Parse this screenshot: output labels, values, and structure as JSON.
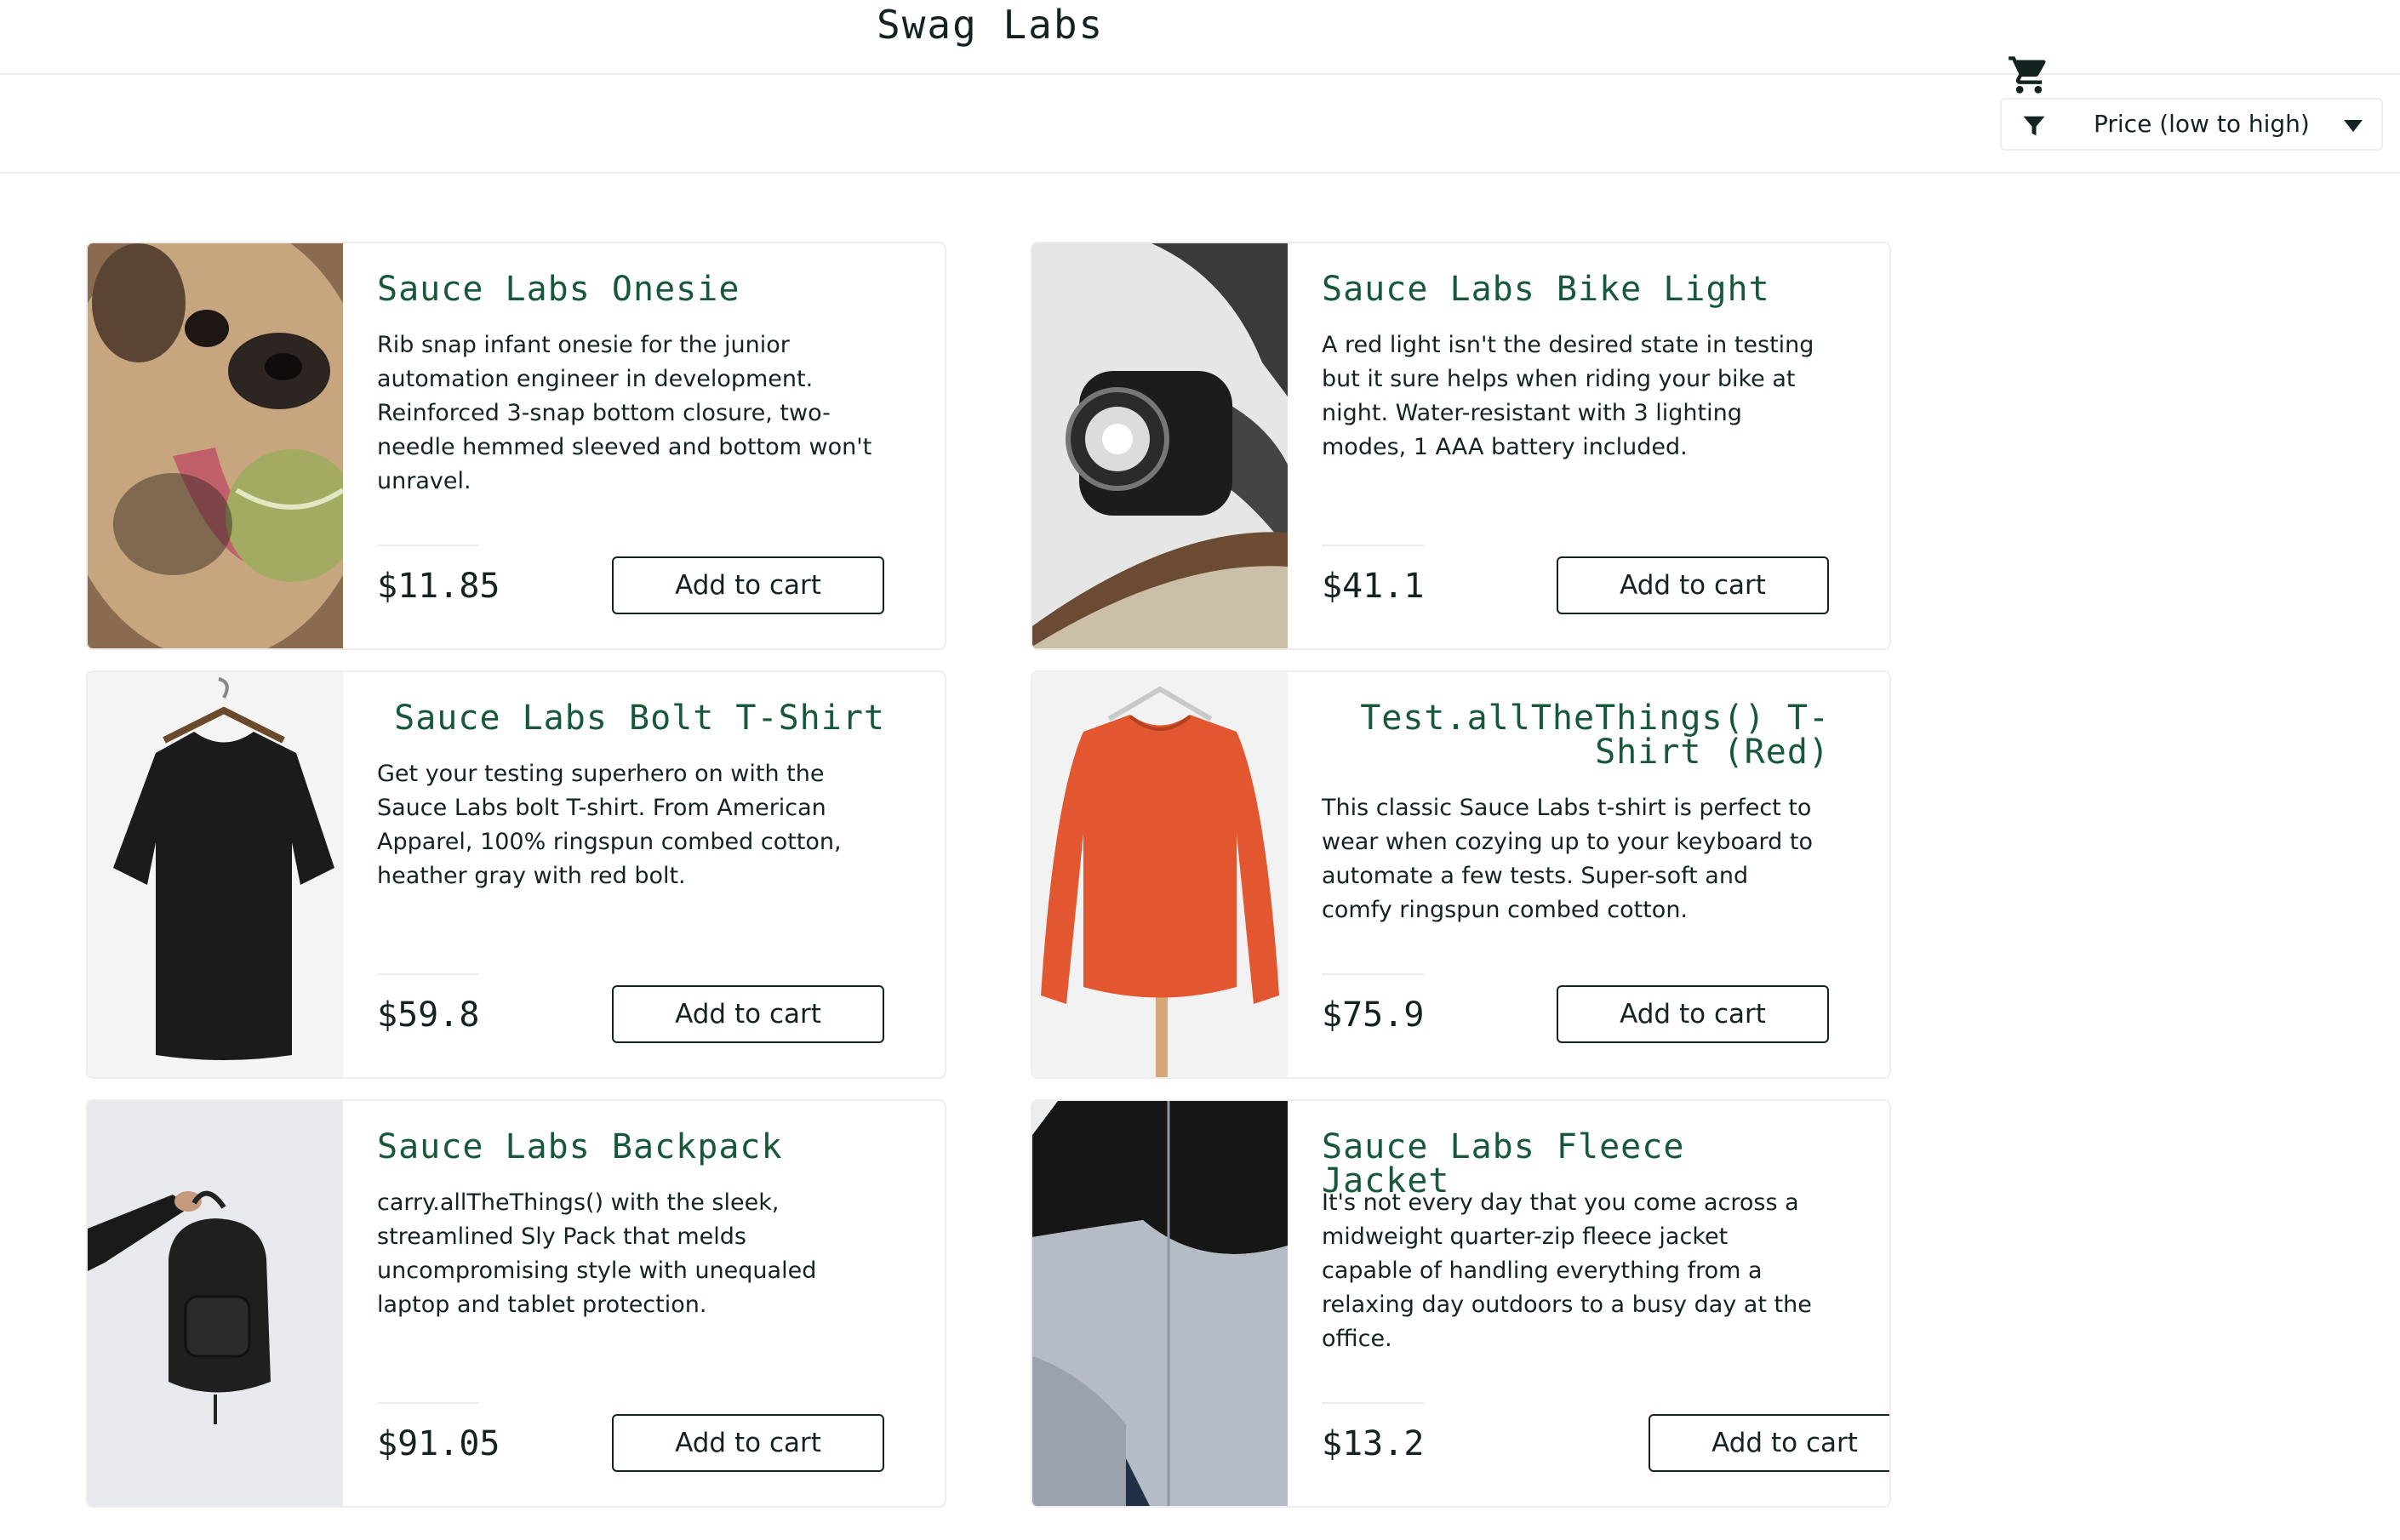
{
  "header": {
    "logo": "Swag Labs"
  },
  "sort": {
    "selected": "Price (low to high)"
  },
  "products": [
    {
      "name": "Sauce Labs Onesie",
      "description": "Rib snap infant onesie for the junior automation engineer in development. Reinforced 3-snap bottom closure, two-needle hemmed sleeved and bottom won't unravel.",
      "price": "$11.85",
      "button": "Add to cart"
    },
    {
      "name": "Sauce Labs Bike Light",
      "description": "A red light isn't the desired state in testing but it sure helps when riding your bike at night. Water-resistant with 3 lighting modes, 1 AAA battery included.",
      "price": "$41.1",
      "button": "Add to cart"
    },
    {
      "name": "Sauce Labs Bolt T-Shirt",
      "description": "Get your testing superhero on with the Sauce Labs bolt T-shirt. From American Apparel, 100% ringspun combed cotton, heather gray with red bolt.",
      "price": "$59.8",
      "button": "Add to cart"
    },
    {
      "name": "Test.allTheThings() T-Shirt (Red)",
      "description": "This classic Sauce Labs t-shirt is perfect to wear when cozying up to your keyboard to automate a few tests. Super-soft and comfy ringspun combed cotton.",
      "price": "$75.9",
      "button": "Add to cart"
    },
    {
      "name": "Sauce Labs Backpack",
      "description": "carry.allTheThings() with the sleek, streamlined Sly Pack that melds uncompromising style with unequaled laptop and tablet protection.",
      "price": "$91.05",
      "button": "Add to cart"
    },
    {
      "name": "Sauce Labs Fleece Jacket",
      "description": "It's not every day that you come across a midweight quarter-zip fleece jacket capable of handling everything from a relaxing day outdoors to a busy day at the office.",
      "price": "$13.2",
      "button": "Add to cart"
    }
  ]
}
